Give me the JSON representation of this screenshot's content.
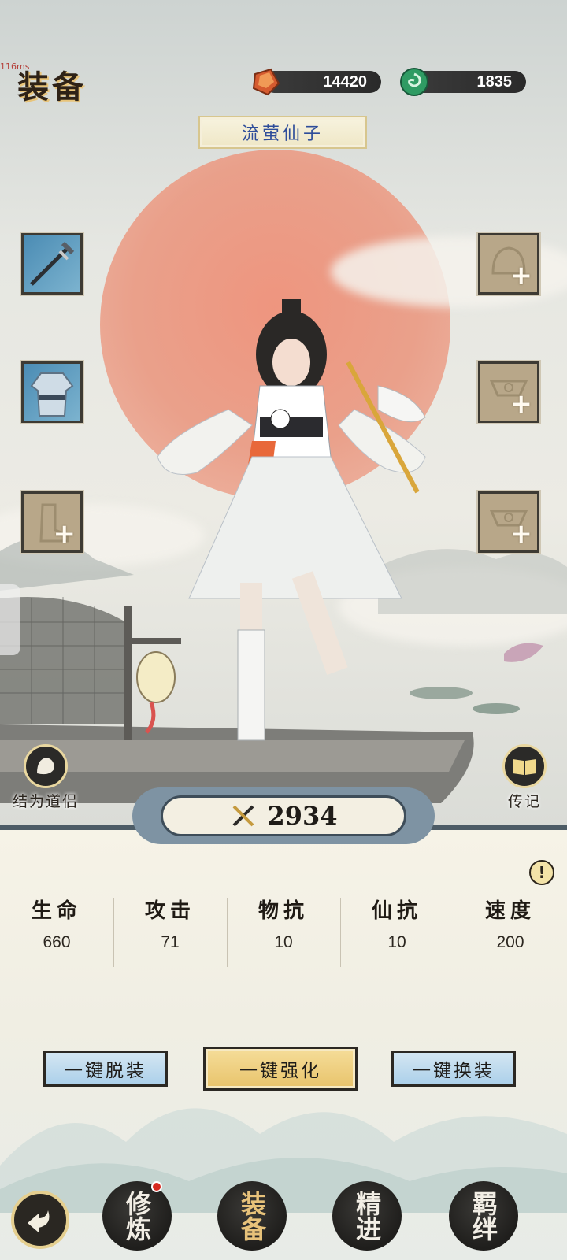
{
  "debug": {
    "ms_label": "116ms"
  },
  "header": {
    "title": "装备",
    "currencies": [
      {
        "icon": "spirit-stone-icon",
        "value": "14420"
      },
      {
        "icon": "jade-coin-icon",
        "value": "1835"
      }
    ]
  },
  "character": {
    "name": "流萤仙子"
  },
  "equipment_slots": {
    "left": [
      {
        "name": "weapon-slot",
        "state": "equipped",
        "icon": "sword-icon"
      },
      {
        "name": "armor-slot",
        "state": "equipped",
        "icon": "robe-icon"
      },
      {
        "name": "boots-slot",
        "state": "empty",
        "icon": "boots-icon",
        "plus": "+"
      }
    ],
    "right": [
      {
        "name": "helmet-slot",
        "state": "empty",
        "icon": "helmet-icon",
        "plus": "+"
      },
      {
        "name": "accessory-slot-1",
        "state": "empty",
        "icon": "accessory-icon",
        "plus": "+"
      },
      {
        "name": "accessory-slot-2",
        "state": "empty",
        "icon": "accessory-icon",
        "plus": "+"
      }
    ]
  },
  "side_buttons": {
    "left": {
      "label": "结为道侣",
      "icon": "companion-icon"
    },
    "right": {
      "label": "传记",
      "icon": "book-icon"
    }
  },
  "power": {
    "value": "2934",
    "icon": "crossed-swords-icon"
  },
  "info_icon": "!",
  "stats": [
    {
      "label": "生命",
      "value": "660"
    },
    {
      "label": "攻击",
      "value": "71"
    },
    {
      "label": "物抗",
      "value": "10"
    },
    {
      "label": "仙抗",
      "value": "10"
    },
    {
      "label": "速度",
      "value": "200"
    }
  ],
  "actions": {
    "unequip_all": "一键脱装",
    "enhance_all": "一键强化",
    "swap_all": "一键换装"
  },
  "bottom_nav": [
    {
      "label": "修炼",
      "active": false,
      "badge": true
    },
    {
      "label": "装备",
      "active": true,
      "badge": false
    },
    {
      "label": "精进",
      "active": false,
      "badge": false
    },
    {
      "label": "羁绊",
      "active": false,
      "badge": false
    }
  ],
  "colors": {
    "sun": "#ea9a83",
    "panel_border": "#4d5c66",
    "name_text": "#2e4d9a",
    "gold_button": "#e8c36b",
    "blue_button": "#acd0ea",
    "badge": "#d7291f"
  }
}
